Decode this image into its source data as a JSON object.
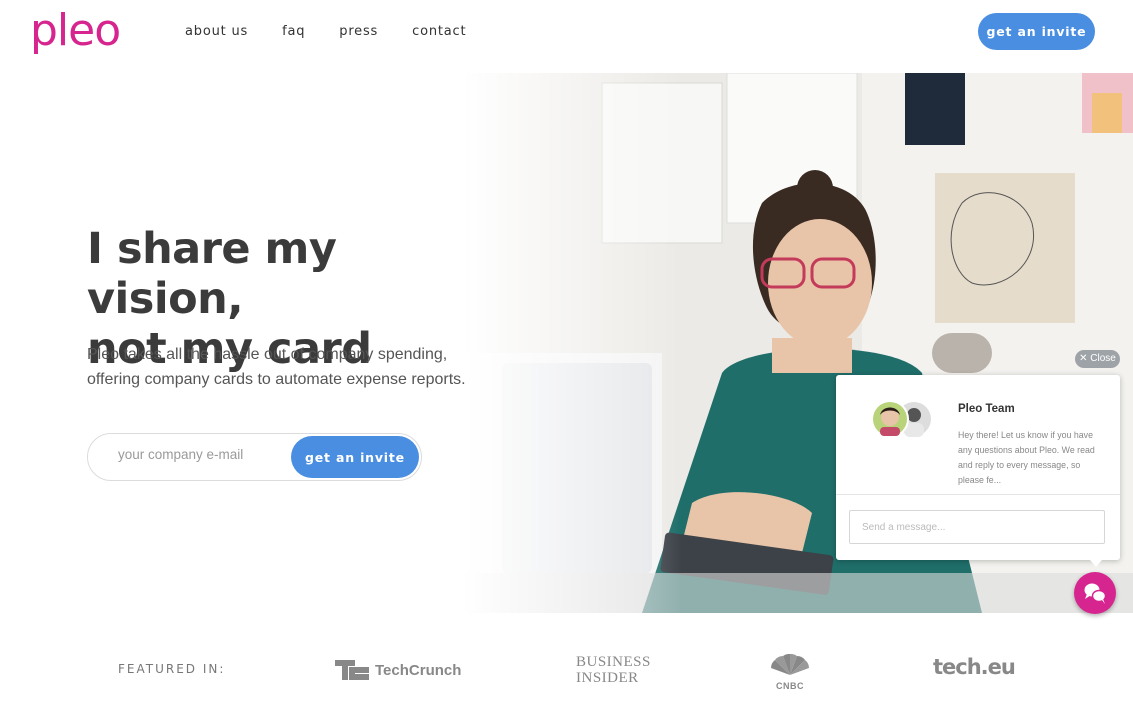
{
  "header": {
    "logo": "pleo",
    "nav": [
      "about us",
      "faq",
      "press",
      "contact"
    ],
    "invite_label": "get an invite"
  },
  "hero": {
    "headline_line1": "I share my vision,",
    "headline_line2": "not my card",
    "subtext_line1": "Pleo takes all the hassle out of company spending,",
    "subtext_line2": "offering company cards to automate expense reports.",
    "email_placeholder": "your company e-mail",
    "invite_label": "get an invite"
  },
  "featured": {
    "label": "FEATURED IN:",
    "logos": {
      "techcrunch": "TechCrunch",
      "business_insider_line1": "BUSINESS",
      "business_insider_line2": "INSIDER",
      "cnbc": "CNBC",
      "techeu": "tech.eu"
    }
  },
  "chat": {
    "close_label": "✕ Close",
    "team_name": "Pleo Team",
    "message": "Hey there! Let us know if you have any questions about Pleo. We read and reply to every message, so please fe...",
    "input_placeholder": "Send a message..."
  },
  "colors": {
    "brand_pink": "#d6258f",
    "button_blue": "#4a8ee2"
  },
  "icons": [
    "close-icon",
    "chat-bubbles-icon",
    "techcrunch-logo-icon",
    "cnbc-peacock-icon"
  ]
}
